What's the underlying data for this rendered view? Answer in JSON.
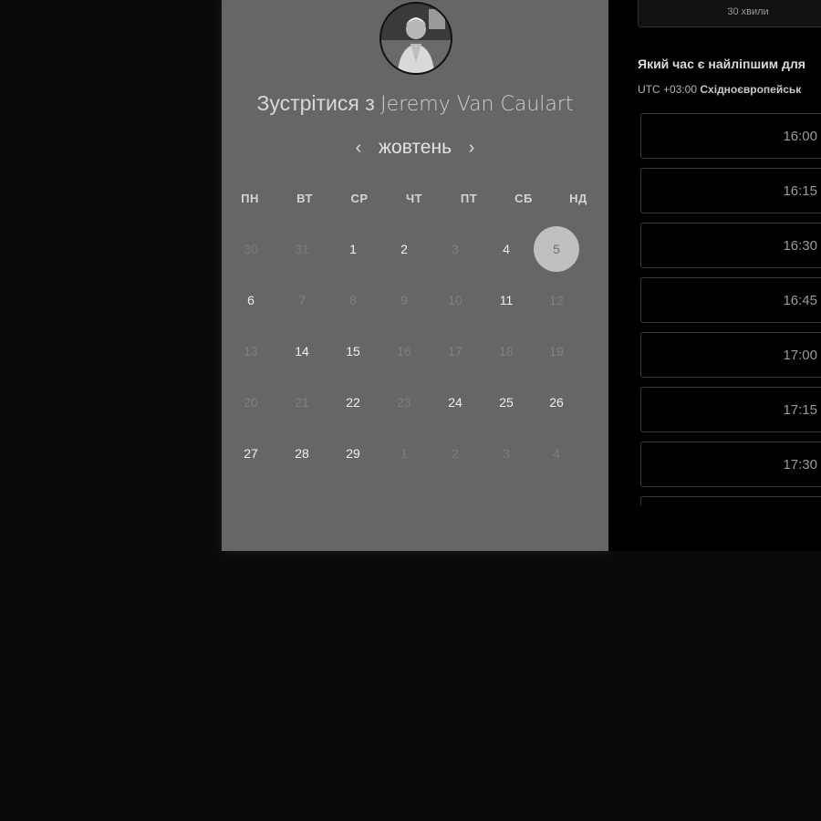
{
  "booking": {
    "title_prefix": "Зустрітися з",
    "host_name": "Jeremy Van Caulart",
    "month": "жовтень",
    "prev_arrow": "‹",
    "next_arrow": "›",
    "weekdays": [
      "ПН",
      "ВТ",
      "СР",
      "ЧТ",
      "ПТ",
      "СБ",
      "НД"
    ],
    "weeks": [
      [
        {
          "n": "30",
          "s": "out"
        },
        {
          "n": "31",
          "s": "out"
        },
        {
          "n": "1",
          "s": "avail"
        },
        {
          "n": "2",
          "s": "avail"
        },
        {
          "n": "3",
          "s": "dim"
        },
        {
          "n": "4",
          "s": "avail"
        },
        {
          "n": "5",
          "s": "selected"
        }
      ],
      [
        {
          "n": "6",
          "s": "avail"
        },
        {
          "n": "7",
          "s": "dim"
        },
        {
          "n": "8",
          "s": "dim"
        },
        {
          "n": "9",
          "s": "dim"
        },
        {
          "n": "10",
          "s": "dim"
        },
        {
          "n": "11",
          "s": "avail"
        },
        {
          "n": "12",
          "s": "dim"
        }
      ],
      [
        {
          "n": "13",
          "s": "dim"
        },
        {
          "n": "14",
          "s": "avail"
        },
        {
          "n": "15",
          "s": "avail"
        },
        {
          "n": "16",
          "s": "dim"
        },
        {
          "n": "17",
          "s": "dim"
        },
        {
          "n": "18",
          "s": "dim"
        },
        {
          "n": "19",
          "s": "dim"
        }
      ],
      [
        {
          "n": "20",
          "s": "dim"
        },
        {
          "n": "21",
          "s": "dim"
        },
        {
          "n": "22",
          "s": "avail"
        },
        {
          "n": "23",
          "s": "dim"
        },
        {
          "n": "24",
          "s": "avail"
        },
        {
          "n": "25",
          "s": "avail"
        },
        {
          "n": "26",
          "s": "avail"
        }
      ],
      [
        {
          "n": "27",
          "s": "avail"
        },
        {
          "n": "28",
          "s": "avail"
        },
        {
          "n": "29",
          "s": "avail"
        },
        {
          "n": "1",
          "s": "out"
        },
        {
          "n": "2",
          "s": "out"
        },
        {
          "n": "3",
          "s": "out"
        },
        {
          "n": "4",
          "s": "out"
        }
      ]
    ]
  },
  "times": {
    "duration": "30 хвили",
    "question": "Який час є найліпшим для",
    "tz_offset": "UTC +03:00",
    "tz_name": "Східноєвропейськ",
    "slots": [
      "16:00",
      "16:15",
      "16:30",
      "16:45",
      "17:00",
      "17:15",
      "17:30",
      ""
    ]
  },
  "colors": {
    "card_bg": "#666666",
    "selected_day": "#c0c0c0",
    "panel_bg": "#000000"
  }
}
